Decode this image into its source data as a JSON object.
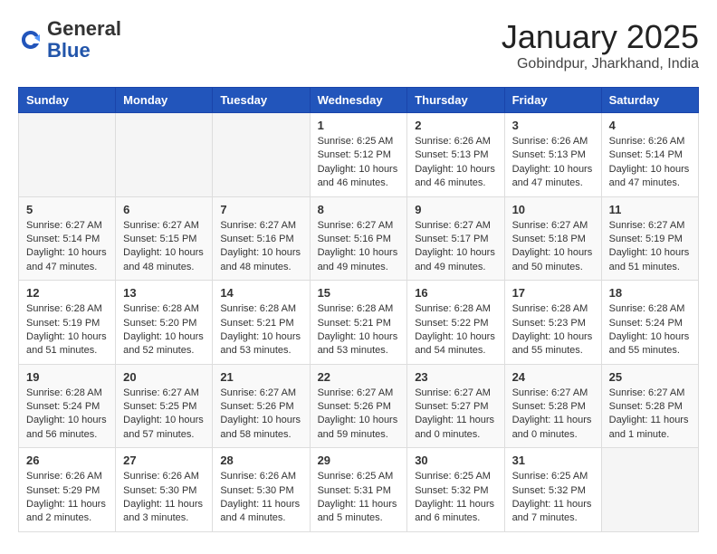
{
  "header": {
    "logo_general": "General",
    "logo_blue": "Blue",
    "month_title": "January 2025",
    "location": "Gobindpur, Jharkhand, India"
  },
  "weekdays": [
    "Sunday",
    "Monday",
    "Tuesday",
    "Wednesday",
    "Thursday",
    "Friday",
    "Saturday"
  ],
  "weeks": [
    [
      {
        "day": "",
        "info": ""
      },
      {
        "day": "",
        "info": ""
      },
      {
        "day": "",
        "info": ""
      },
      {
        "day": "1",
        "info": "Sunrise: 6:25 AM\nSunset: 5:12 PM\nDaylight: 10 hours\nand 46 minutes."
      },
      {
        "day": "2",
        "info": "Sunrise: 6:26 AM\nSunset: 5:13 PM\nDaylight: 10 hours\nand 46 minutes."
      },
      {
        "day": "3",
        "info": "Sunrise: 6:26 AM\nSunset: 5:13 PM\nDaylight: 10 hours\nand 47 minutes."
      },
      {
        "day": "4",
        "info": "Sunrise: 6:26 AM\nSunset: 5:14 PM\nDaylight: 10 hours\nand 47 minutes."
      }
    ],
    [
      {
        "day": "5",
        "info": "Sunrise: 6:27 AM\nSunset: 5:14 PM\nDaylight: 10 hours\nand 47 minutes."
      },
      {
        "day": "6",
        "info": "Sunrise: 6:27 AM\nSunset: 5:15 PM\nDaylight: 10 hours\nand 48 minutes."
      },
      {
        "day": "7",
        "info": "Sunrise: 6:27 AM\nSunset: 5:16 PM\nDaylight: 10 hours\nand 48 minutes."
      },
      {
        "day": "8",
        "info": "Sunrise: 6:27 AM\nSunset: 5:16 PM\nDaylight: 10 hours\nand 49 minutes."
      },
      {
        "day": "9",
        "info": "Sunrise: 6:27 AM\nSunset: 5:17 PM\nDaylight: 10 hours\nand 49 minutes."
      },
      {
        "day": "10",
        "info": "Sunrise: 6:27 AM\nSunset: 5:18 PM\nDaylight: 10 hours\nand 50 minutes."
      },
      {
        "day": "11",
        "info": "Sunrise: 6:27 AM\nSunset: 5:19 PM\nDaylight: 10 hours\nand 51 minutes."
      }
    ],
    [
      {
        "day": "12",
        "info": "Sunrise: 6:28 AM\nSunset: 5:19 PM\nDaylight: 10 hours\nand 51 minutes."
      },
      {
        "day": "13",
        "info": "Sunrise: 6:28 AM\nSunset: 5:20 PM\nDaylight: 10 hours\nand 52 minutes."
      },
      {
        "day": "14",
        "info": "Sunrise: 6:28 AM\nSunset: 5:21 PM\nDaylight: 10 hours\nand 53 minutes."
      },
      {
        "day": "15",
        "info": "Sunrise: 6:28 AM\nSunset: 5:21 PM\nDaylight: 10 hours\nand 53 minutes."
      },
      {
        "day": "16",
        "info": "Sunrise: 6:28 AM\nSunset: 5:22 PM\nDaylight: 10 hours\nand 54 minutes."
      },
      {
        "day": "17",
        "info": "Sunrise: 6:28 AM\nSunset: 5:23 PM\nDaylight: 10 hours\nand 55 minutes."
      },
      {
        "day": "18",
        "info": "Sunrise: 6:28 AM\nSunset: 5:24 PM\nDaylight: 10 hours\nand 55 minutes."
      }
    ],
    [
      {
        "day": "19",
        "info": "Sunrise: 6:28 AM\nSunset: 5:24 PM\nDaylight: 10 hours\nand 56 minutes."
      },
      {
        "day": "20",
        "info": "Sunrise: 6:27 AM\nSunset: 5:25 PM\nDaylight: 10 hours\nand 57 minutes."
      },
      {
        "day": "21",
        "info": "Sunrise: 6:27 AM\nSunset: 5:26 PM\nDaylight: 10 hours\nand 58 minutes."
      },
      {
        "day": "22",
        "info": "Sunrise: 6:27 AM\nSunset: 5:26 PM\nDaylight: 10 hours\nand 59 minutes."
      },
      {
        "day": "23",
        "info": "Sunrise: 6:27 AM\nSunset: 5:27 PM\nDaylight: 11 hours\nand 0 minutes."
      },
      {
        "day": "24",
        "info": "Sunrise: 6:27 AM\nSunset: 5:28 PM\nDaylight: 11 hours\nand 0 minutes."
      },
      {
        "day": "25",
        "info": "Sunrise: 6:27 AM\nSunset: 5:28 PM\nDaylight: 11 hours\nand 1 minute."
      }
    ],
    [
      {
        "day": "26",
        "info": "Sunrise: 6:26 AM\nSunset: 5:29 PM\nDaylight: 11 hours\nand 2 minutes."
      },
      {
        "day": "27",
        "info": "Sunrise: 6:26 AM\nSunset: 5:30 PM\nDaylight: 11 hours\nand 3 minutes."
      },
      {
        "day": "28",
        "info": "Sunrise: 6:26 AM\nSunset: 5:30 PM\nDaylight: 11 hours\nand 4 minutes."
      },
      {
        "day": "29",
        "info": "Sunrise: 6:25 AM\nSunset: 5:31 PM\nDaylight: 11 hours\nand 5 minutes."
      },
      {
        "day": "30",
        "info": "Sunrise: 6:25 AM\nSunset: 5:32 PM\nDaylight: 11 hours\nand 6 minutes."
      },
      {
        "day": "31",
        "info": "Sunrise: 6:25 AM\nSunset: 5:32 PM\nDaylight: 11 hours\nand 7 minutes."
      },
      {
        "day": "",
        "info": ""
      }
    ]
  ]
}
